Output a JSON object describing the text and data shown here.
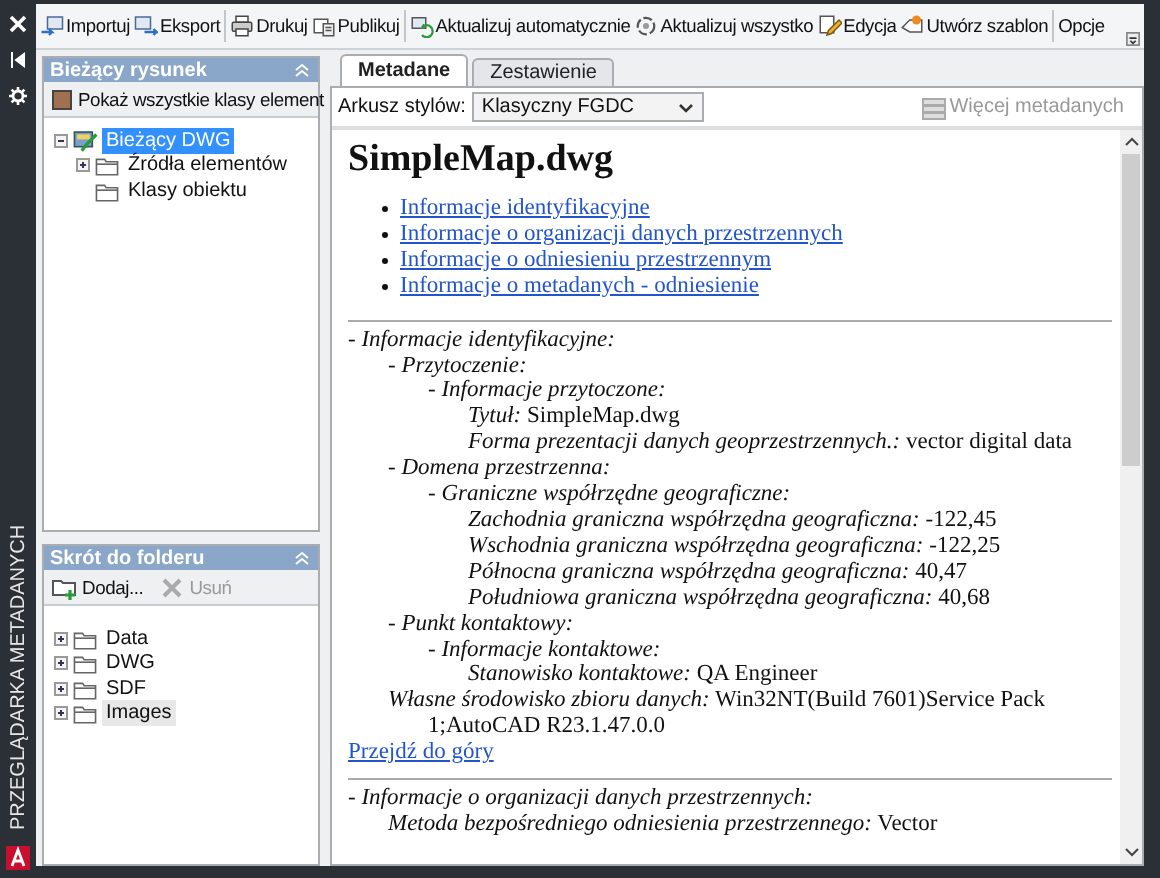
{
  "palette": {
    "title": "PRZEGLĄDARKA METADANYCH"
  },
  "toolbar": {
    "groups": [
      {
        "items": [
          {
            "label": "Importuj"
          },
          {
            "label": "Eksport"
          }
        ]
      },
      {
        "items": [
          {
            "label": "Drukuj"
          },
          {
            "label": "Publikuj"
          }
        ]
      },
      {
        "items": [
          {
            "label": "Aktualizuj automatycznie"
          },
          {
            "label": "Aktualizuj wszystko"
          },
          {
            "label": "Edycja"
          },
          {
            "label": "Utwórz szablon"
          }
        ]
      },
      {
        "items": [
          {
            "label": "Opcje"
          }
        ]
      }
    ]
  },
  "current_drawing": {
    "title": "Bieżący rysunek",
    "show_all_button": "Pokaż wszystkie klasy element",
    "tree": [
      {
        "label": "Bieżący DWG",
        "selected": true,
        "expanded": true,
        "children": [
          {
            "label": "Źródła elementów",
            "selected": false,
            "expanded": false
          },
          {
            "label": "Klasy obiektu",
            "selected": false
          }
        ]
      }
    ]
  },
  "folder_shortcut": {
    "title": "Skrót do folderu",
    "buttons": [
      {
        "label": "Dodaj...",
        "disabled": false
      },
      {
        "label": "Usuń",
        "disabled": true
      }
    ],
    "tree": [
      {
        "label": "Data",
        "selected": false,
        "expanded": false
      },
      {
        "label": "DWG",
        "selected": false,
        "expanded": false
      },
      {
        "label": "SDF",
        "selected": false,
        "expanded": false
      },
      {
        "label": "Images",
        "selected": true,
        "expanded": false
      }
    ]
  },
  "tabs": [
    {
      "label": "Metadane",
      "selected": true
    },
    {
      "label": "Zestawienie",
      "selected": false
    }
  ],
  "stylesheet": {
    "label": "Arkusz stylów:",
    "value": "Klasyczny FGDC"
  },
  "more_metadata_button": {
    "label": "Więcej metadanych",
    "disabled": true
  },
  "document": {
    "title": "SimpleMap.dwg",
    "links": [
      "Informacje identyfikacyjne",
      "Informacje o organizacji danych przestrzennych",
      "Informacje o odniesieniu przestrzennym",
      "Informacje o metadanych - odniesienie"
    ],
    "sections": [
      {
        "entries": [
          {
            "label": "- Informacje identyfikacyjne:",
            "children": [
              {
                "label": "- Przytoczenie:",
                "children": [
                  {
                    "label": "- Informacje przytoczone:",
                    "children": [
                      {
                        "label": "Tytuł:",
                        "value": "SimpleMap.dwg"
                      },
                      {
                        "label": "Forma prezentacji danych geoprzestrzennych.:",
                        "value": "vector digital data"
                      }
                    ]
                  }
                ]
              },
              {
                "label": "- Domena przestrzenna:",
                "children": [
                  {
                    "label": "- Graniczne współrzędne geograficzne:",
                    "children": [
                      {
                        "label": "Zachodnia graniczna współrzędna geograficzna:",
                        "value": "-122,45"
                      },
                      {
                        "label": "Wschodnia graniczna współrzędna geograficzna:",
                        "value": "-122,25"
                      },
                      {
                        "label": "Północna graniczna współrzędna geograficzna:",
                        "value": "40,47"
                      },
                      {
                        "label": "Południowa graniczna współrzędna geograficzna:",
                        "value": "40,68"
                      }
                    ]
                  }
                ]
              },
              {
                "label": "- Punkt kontaktowy:",
                "children": [
                  {
                    "label": "- Informacje kontaktowe:",
                    "children": [
                      {
                        "label": "Stanowisko kontaktowe:",
                        "value": "QA Engineer"
                      }
                    ]
                  }
                ]
              },
              {
                "label": "Własne środowisko zbioru danych:",
                "value": "Win32NT(Build 7601)Service Pack 1;AutoCAD R23.1.47.0.0"
              }
            ]
          }
        ],
        "back_link": "Przejdź do góry"
      },
      {
        "entries": [
          {
            "label": "- Informacje o organizacji danych przestrzennych:",
            "children": [
              {
                "label": "Metoda bezpośredniego odniesienia przestrzennego:",
                "value": "Vector"
              }
            ]
          }
        ]
      }
    ]
  }
}
